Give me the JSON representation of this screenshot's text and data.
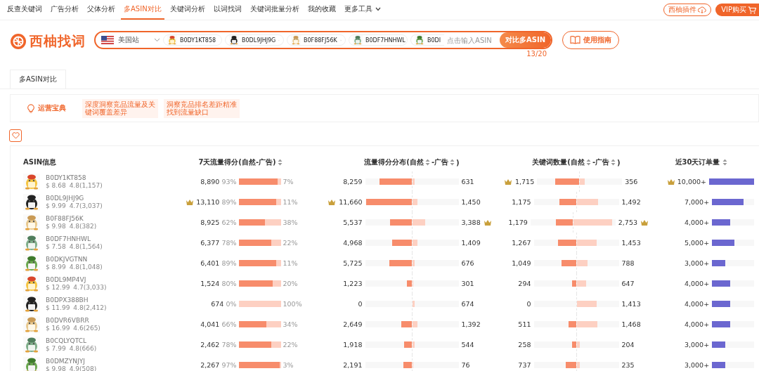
{
  "nav": {
    "items": [
      {
        "label": "反查关键词",
        "selected": false,
        "kind": "link"
      },
      {
        "label": "广告分析",
        "selected": false,
        "kind": "link"
      },
      {
        "label": "父体分析",
        "selected": false,
        "kind": "link"
      },
      {
        "label": "多ASIN对比",
        "selected": true,
        "kind": "link"
      },
      {
        "label": "关键词分析",
        "selected": false,
        "kind": "link"
      },
      {
        "label": "以词找词",
        "selected": false,
        "kind": "link"
      },
      {
        "label": "关键词批量分析",
        "selected": false,
        "kind": "link"
      },
      {
        "label": "我的收藏",
        "selected": false,
        "kind": "link"
      },
      {
        "label": "更多工具",
        "selected": false,
        "kind": "dropdown"
      }
    ],
    "plugin_button": "西柚插件",
    "vip_button": "VIP购买"
  },
  "logo": "西柚找词",
  "search": {
    "marketplace": "美国站",
    "chips": [
      {
        "asin": "B0DY1KT858",
        "truncated": false
      },
      {
        "asin": "B0DL9JHJ9G",
        "truncated": false
      },
      {
        "asin": "B0F88FJ56K",
        "truncated": false
      },
      {
        "asin": "B0DF7HNHWL",
        "truncated": false
      },
      {
        "asin": "B0DI",
        "truncated": true
      }
    ],
    "placeholder": "点击输入ASIN",
    "button": "对比多ASIN",
    "count": "13/20"
  },
  "guide_button": "使用指南",
  "tabs": [
    {
      "label": "多ASIN对比",
      "selected": true
    }
  ],
  "tips": {
    "title": "运营宝典",
    "items": [
      "深度洞察竞品流量及关键词覆盖差异",
      "洞察竞品排名差距精准找到流量缺口"
    ]
  },
  "favorite": {
    "on": false
  },
  "table": {
    "columns": [
      {
        "segments": [
          {
            "text": "ASIN信息",
            "sortable": false
          }
        ]
      },
      {
        "segments": [
          {
            "text": "7天流量得分(自然-广告)",
            "sortable": true
          }
        ]
      },
      {
        "segments": [
          {
            "text": "流量得分分布(自然",
            "sortable": true
          },
          {
            "text": "-广告",
            "sortable": true
          },
          {
            "text": ")",
            "sortable": false
          }
        ]
      },
      {
        "segments": [
          {
            "text": "关键词数量(自然",
            "sortable": true
          },
          {
            "text": "-广告",
            "sortable": true
          },
          {
            "text": ")",
            "sortable": false
          }
        ]
      },
      {
        "segments": [
          {
            "text": "近30天订单量",
            "sortable": true
          }
        ]
      }
    ],
    "rows": [
      {
        "asin": "B0DY1KT858",
        "price": "$ 8.68",
        "rating": "4.8(1,157)",
        "score": {
          "total": "8,890",
          "organic_pct": "93%",
          "ad_pct": "7%",
          "level": 0.93,
          "top": false
        },
        "traffic": {
          "organic": {
            "value": "8,259",
            "level": 0.69,
            "top": false
          },
          "ad": {
            "value": "631",
            "level": 0.05,
            "top": false
          }
        },
        "keywords": {
          "organic": {
            "value": "1,715",
            "level": 0.57,
            "top": true
          },
          "ad": {
            "value": "356",
            "level": 0.12,
            "top": false
          }
        },
        "orders": {
          "value": "10,000+",
          "level": 1,
          "top": true
        }
      },
      {
        "asin": "B0DL9JHJ9G",
        "price": "$ 9.99",
        "rating": "4.7(3,037)",
        "score": {
          "total": "13,110",
          "organic_pct": "89%",
          "ad_pct": "11%",
          "level": 0.89,
          "top": true
        },
        "traffic": {
          "organic": {
            "value": "11,660",
            "level": 0.97,
            "top": true
          },
          "ad": {
            "value": "1,450",
            "level": 0.12,
            "top": false
          }
        },
        "keywords": {
          "organic": {
            "value": "1,175",
            "level": 0.39,
            "top": false
          },
          "ad": {
            "value": "1,492",
            "level": 0.5,
            "top": false
          }
        },
        "orders": {
          "value": "7,000+",
          "level": 0.7,
          "top": false
        }
      },
      {
        "asin": "B0F88FJ56K",
        "price": "$ 9.98",
        "rating": "4.8(382)",
        "score": {
          "total": "8,925",
          "organic_pct": "62%",
          "ad_pct": "38%",
          "level": 0.62,
          "top": false
        },
        "traffic": {
          "organic": {
            "value": "5,537",
            "level": 0.46,
            "top": false
          },
          "ad": {
            "value": "3,388",
            "level": 0.28,
            "top": true
          }
        },
        "keywords": {
          "organic": {
            "value": "1,179",
            "level": 0.39,
            "top": false
          },
          "ad": {
            "value": "2,753",
            "level": 0.92,
            "top": true
          }
        },
        "orders": {
          "value": "4,000+",
          "level": 0.4,
          "top": false
        }
      },
      {
        "asin": "B0DF7HNHWL",
        "price": "$ 7.58",
        "rating": "4.8(1,564)",
        "score": {
          "total": "6,377",
          "organic_pct": "78%",
          "ad_pct": "22%",
          "level": 0.78,
          "top": false
        },
        "traffic": {
          "organic": {
            "value": "4,968",
            "level": 0.41,
            "top": false
          },
          "ad": {
            "value": "1,409",
            "level": 0.12,
            "top": false
          }
        },
        "keywords": {
          "organic": {
            "value": "1,267",
            "level": 0.42,
            "top": false
          },
          "ad": {
            "value": "1,453",
            "level": 0.48,
            "top": false
          }
        },
        "orders": {
          "value": "5,000+",
          "level": 0.5,
          "top": false
        }
      },
      {
        "asin": "B0DKJVGTNN",
        "price": "$ 8.99",
        "rating": "4.8(1,048)",
        "score": {
          "total": "6,401",
          "organic_pct": "89%",
          "ad_pct": "11%",
          "level": 0.89,
          "top": false
        },
        "traffic": {
          "organic": {
            "value": "5,725",
            "level": 0.48,
            "top": false
          },
          "ad": {
            "value": "676",
            "level": 0.06,
            "top": false
          }
        },
        "keywords": {
          "organic": {
            "value": "1,049",
            "level": 0.35,
            "top": false
          },
          "ad": {
            "value": "788",
            "level": 0.26,
            "top": false
          }
        },
        "orders": {
          "value": "3,000+",
          "level": 0.3,
          "top": false
        }
      },
      {
        "asin": "B0DL9MP4VJ",
        "price": "$ 12.99",
        "rating": "4.7(3,033)",
        "score": {
          "total": "1,524",
          "organic_pct": "80%",
          "ad_pct": "20%",
          "level": 0.8,
          "top": false
        },
        "traffic": {
          "organic": {
            "value": "1,223",
            "level": 0.1,
            "top": false
          },
          "ad": {
            "value": "301",
            "level": 0.03,
            "top": false
          }
        },
        "keywords": {
          "organic": {
            "value": "294",
            "level": 0.1,
            "top": false
          },
          "ad": {
            "value": "647",
            "level": 0.22,
            "top": false
          }
        },
        "orders": {
          "value": "4,000+",
          "level": 0.4,
          "top": false
        }
      },
      {
        "asin": "B0DPX388BH",
        "price": "$ 11.99",
        "rating": "4.8(2,412)",
        "score": {
          "total": "674",
          "organic_pct": "0%",
          "ad_pct": "100%",
          "level": 0,
          "top": false
        },
        "traffic": {
          "organic": {
            "value": "0",
            "level": 0,
            "top": false
          },
          "ad": {
            "value": "674",
            "level": 0.06,
            "top": false
          }
        },
        "keywords": {
          "organic": {
            "value": "0",
            "level": 0,
            "top": false
          },
          "ad": {
            "value": "1,413",
            "level": 0.47,
            "top": false
          }
        },
        "orders": {
          "value": "4,000+",
          "level": 0.4,
          "top": false
        }
      },
      {
        "asin": "B0DVR6VBRR",
        "price": "$ 16.99",
        "rating": "4.6(265)",
        "score": {
          "total": "4,041",
          "organic_pct": "66%",
          "ad_pct": "34%",
          "level": 0.66,
          "top": false
        },
        "traffic": {
          "organic": {
            "value": "2,649",
            "level": 0.22,
            "top": false
          },
          "ad": {
            "value": "1,392",
            "level": 0.12,
            "top": false
          }
        },
        "keywords": {
          "organic": {
            "value": "511",
            "level": 0.17,
            "top": false
          },
          "ad": {
            "value": "1,468",
            "level": 0.49,
            "top": false
          }
        },
        "orders": {
          "value": "4,000+",
          "level": 0.4,
          "top": false
        }
      },
      {
        "asin": "B0CQLYQTCL",
        "price": "$ 7.99",
        "rating": "4.8(666)",
        "score": {
          "total": "2,462",
          "organic_pct": "78%",
          "ad_pct": "22%",
          "level": 0.78,
          "top": false
        },
        "traffic": {
          "organic": {
            "value": "1,918",
            "level": 0.16,
            "top": false
          },
          "ad": {
            "value": "544",
            "level": 0.05,
            "top": false
          }
        },
        "keywords": {
          "organic": {
            "value": "258",
            "level": 0.09,
            "top": false
          },
          "ad": {
            "value": "204",
            "level": 0.07,
            "top": false
          }
        },
        "orders": {
          "value": "3,000+",
          "level": 0.3,
          "top": false
        }
      },
      {
        "asin": "B0DMZYNJYJ",
        "price": "$ 9.98",
        "rating": "4.9(508)",
        "score": {
          "total": "2,267",
          "organic_pct": "97%",
          "ad_pct": "3%",
          "level": 0.97,
          "top": false
        },
        "traffic": {
          "organic": {
            "value": "2,191",
            "level": 0.18,
            "top": false
          },
          "ad": {
            "value": "76",
            "level": 0.01,
            "top": false
          }
        },
        "keywords": {
          "organic": {
            "value": "737",
            "level": 0.25,
            "top": false
          },
          "ad": {
            "value": "235",
            "level": 0.08,
            "top": false
          }
        },
        "orders": {
          "value": "3,000+",
          "level": 0.3,
          "top": false
        }
      }
    ]
  }
}
